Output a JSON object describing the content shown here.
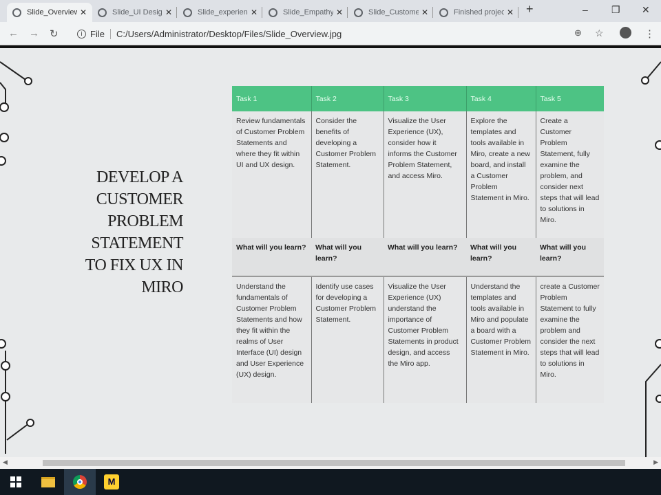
{
  "browser": {
    "tabs": [
      {
        "label": "Slide_Overview",
        "active": true
      },
      {
        "label": "Slide_UI Design"
      },
      {
        "label": "Slide_experience"
      },
      {
        "label": "Slide_Empathy"
      },
      {
        "label": "Slide_Customer"
      },
      {
        "label": "Finished project"
      }
    ],
    "new_tab": "+",
    "file_label": "File",
    "url": "C:/Users/Administrator/Desktop/Files/Slide_Overview.jpg"
  },
  "slide": {
    "title": "DEVELOP A CUSTOMER PROBLEM STATEMENT TO FIX UX IN MIRO",
    "headers": [
      "Task 1",
      "Task 2",
      "Task 3",
      "Task 4",
      "Task 5"
    ],
    "tasks": [
      "Review fundamentals of Customer Problem Statements and where they fit within UI and UX design.",
      "Consider the benefits of developing a Customer Problem Statement.",
      "Visualize the User Experience (UX), consider how it informs the Customer Problem Statement, and access Miro.",
      "Explore the templates and tools available in Miro, create a new board, and install a Customer Problem Statement in Miro.",
      "Create a Customer Problem Statement, fully examine the problem, and consider next steps that will lead to solutions in Miro."
    ],
    "learn_label": "What will you learn?",
    "learn": [
      "Understand the fundamentals of Customer Problem Statements and how they fit within the realms of User Interface (UI) design and User Experience (UX) design.",
      "Identify use cases for developing a Customer Problem Statement.",
      "Visualize the User Experience (UX) understand the importance of Customer Problem Statements in product design, and access the Miro app.",
      "Understand the templates and tools available in Miro and populate a board with a Customer Problem Statement in Miro.",
      "create a Customer Problem Statement to fully examine the problem and consider the next steps that will lead to solutions in Miro."
    ]
  },
  "colors": {
    "header_green": "#4dc384",
    "taskbar": "#101820"
  }
}
